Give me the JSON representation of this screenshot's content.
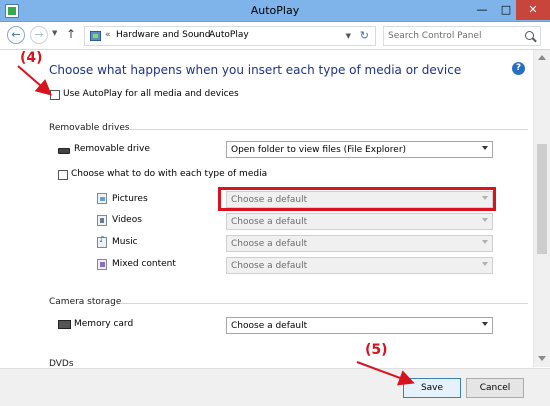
{
  "window": {
    "title": "AutoPlay",
    "minimize_glyph": "—",
    "maximize_glyph": "□",
    "close_glyph": "✕"
  },
  "address": {
    "back_glyph": "←",
    "forward_glyph": "→",
    "up_glyph": "↑",
    "prefix": "«",
    "breadcrumb": [
      "Hardware and Sound",
      "AutoPlay"
    ],
    "separator": "›",
    "refresh_glyph": "↻",
    "search_placeholder": "Search Control Panel"
  },
  "main": {
    "heading": "Choose what happens when you insert each type of media or device",
    "help_glyph": "?",
    "use_autoplay_label": "Use AutoPlay for all media and devices",
    "use_autoplay_checked": false
  },
  "removable": {
    "section_title": "Removable drives",
    "drive_label": "Removable drive",
    "drive_value": "Open folder to view files (File Explorer)",
    "choose_each_label": "Choose what to do with each type of media",
    "choose_each_checked": false,
    "media": [
      {
        "label": "Pictures",
        "value": "Choose a default",
        "icon": "pictures-icon"
      },
      {
        "label": "Videos",
        "value": "Choose a default",
        "icon": "videos-icon"
      },
      {
        "label": "Music",
        "value": "Choose a default",
        "icon": "music-icon"
      },
      {
        "label": "Mixed content",
        "value": "Choose a default",
        "icon": "mixed-content-icon"
      }
    ]
  },
  "camera": {
    "section_title": "Camera storage",
    "memory_card_label": "Memory card",
    "memory_card_value": "Choose a default"
  },
  "dvds": {
    "section_title": "DVDs"
  },
  "buttons": {
    "save": "Save",
    "cancel": "Cancel"
  },
  "annotations": {
    "step4": "(4)",
    "step5": "(5)",
    "color": "#d8131e"
  }
}
